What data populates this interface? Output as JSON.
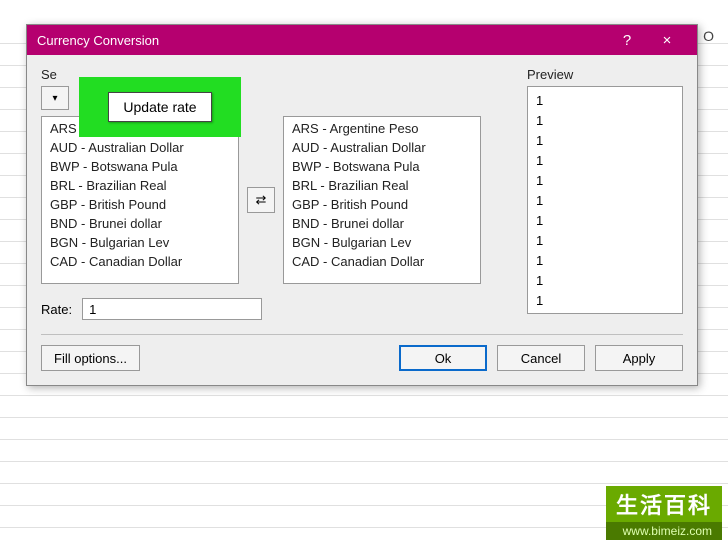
{
  "spreadsheet": {
    "visible_column": "O"
  },
  "dialog": {
    "title": "Currency Conversion",
    "help_tooltip": "?",
    "close_tooltip": "×",
    "section_prefix": "Se",
    "highlight": {
      "label": "Update rate"
    },
    "source_list": [
      "ARS - Argentine Peso",
      "AUD - Australian Dollar",
      "BWP - Botswana Pula",
      "BRL - Brazilian Real",
      "GBP - British Pound",
      "BND - Brunei dollar",
      "BGN - Bulgarian Lev",
      "CAD - Canadian Dollar"
    ],
    "target_list": [
      "ARS - Argentine Peso",
      "AUD - Australian Dollar",
      "BWP - Botswana Pula",
      "BRL - Brazilian Real",
      "GBP - British Pound",
      "BND - Brunei dollar",
      "BGN - Bulgarian Lev",
      "CAD - Canadian Dollar"
    ],
    "swap_icon": "⇄",
    "rate_label": "Rate:",
    "rate_value": "1",
    "preview_label": "Preview",
    "preview_values": [
      "1",
      "1",
      "1",
      "1",
      "1",
      "1",
      "1",
      "1",
      "1",
      "1",
      "1"
    ],
    "fill_options": "Fill options...",
    "ok": "Ok",
    "cancel": "Cancel",
    "apply": "Apply"
  },
  "watermark": {
    "top": "生活百科",
    "bottom": "www.bimeiz.com"
  }
}
